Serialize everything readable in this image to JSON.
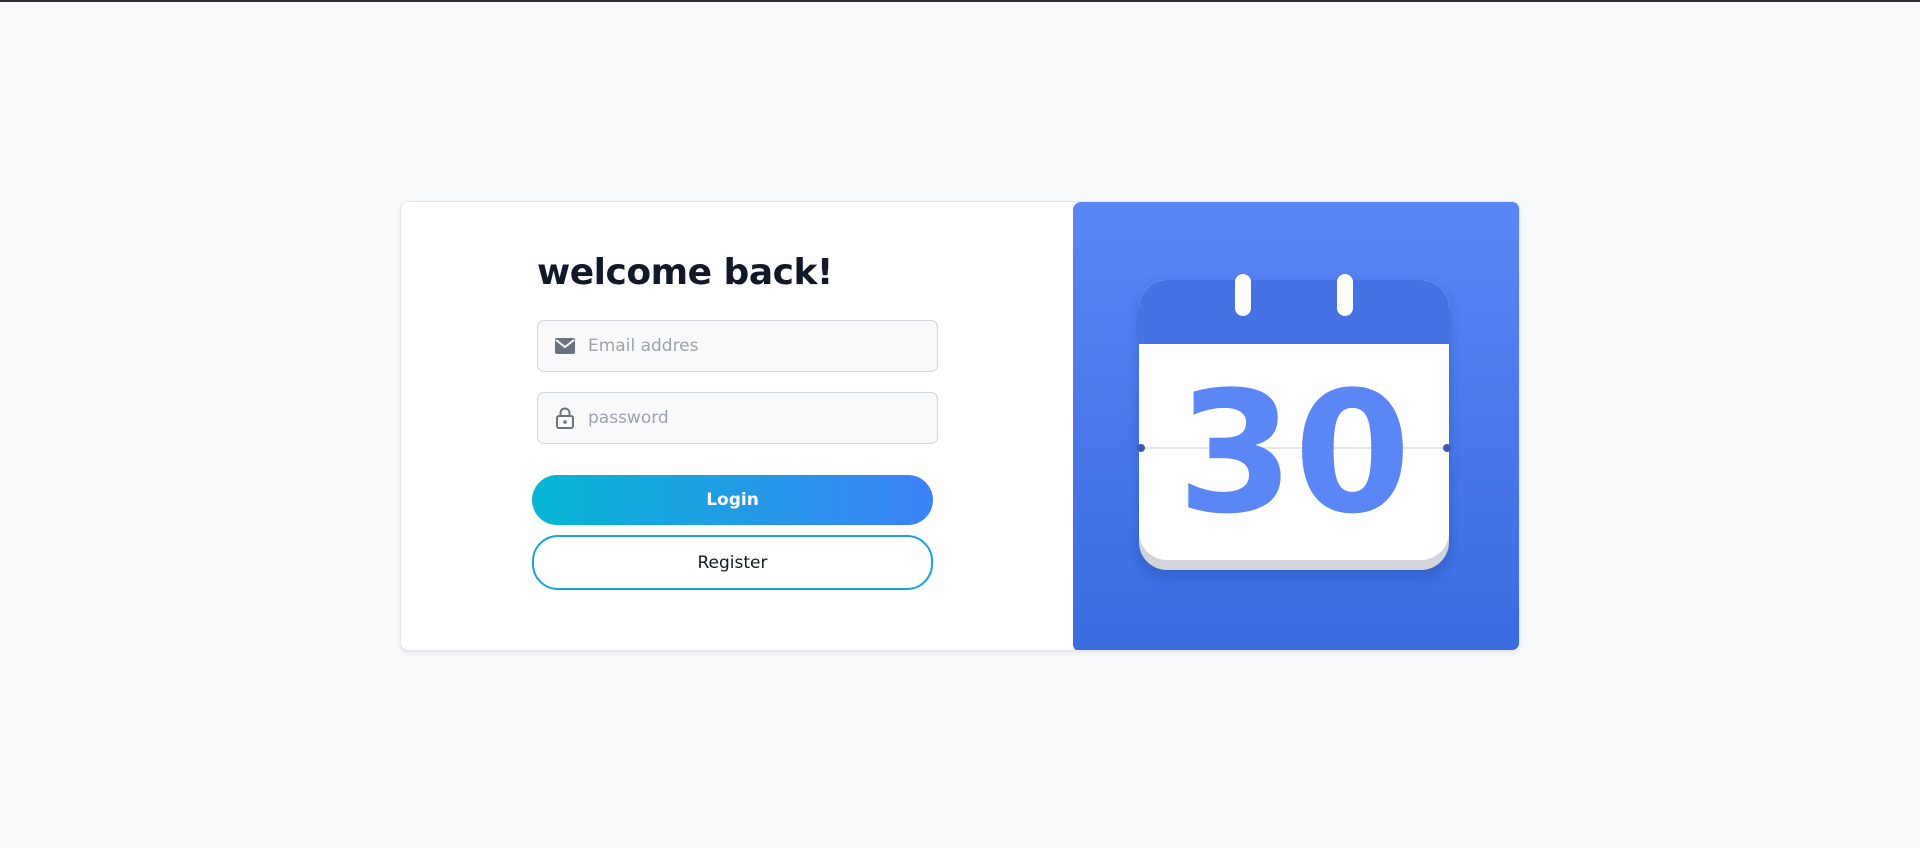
{
  "form": {
    "title": "welcome back!",
    "email_placeholder": "Email addres",
    "password_placeholder": "password",
    "login_label": "Login",
    "register_label": "Register"
  },
  "illustration": {
    "calendar_day": "30",
    "icon": "calendar-icon"
  },
  "colors": {
    "background": "#f8f9fb",
    "panel_blue": "#4a7cf0",
    "calendar_number": "#5b86f5",
    "login_gradient_start": "#06b6d4",
    "login_gradient_end": "#3b82f6",
    "register_border": "#1ea1dc",
    "title": "#111827"
  },
  "icons": {
    "email": "envelope-icon",
    "password": "lock-icon"
  }
}
